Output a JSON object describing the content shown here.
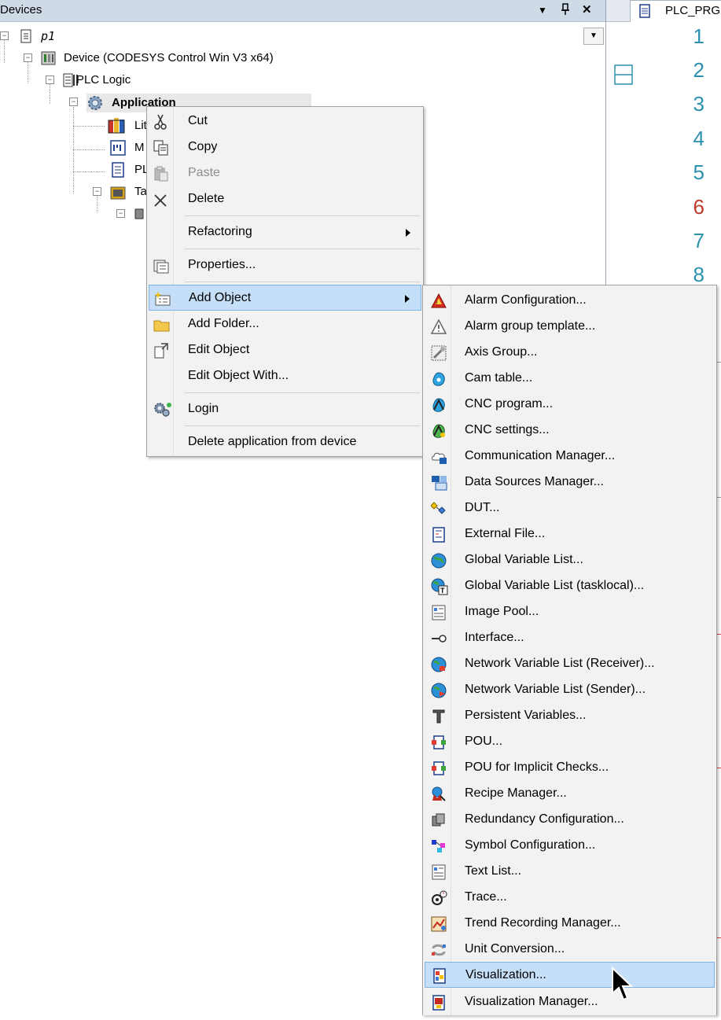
{
  "devices_panel": {
    "title": "Devices",
    "dropdown_glyph": "▼",
    "pin_glyph": "ᛘ",
    "close_glyph": "✕",
    "project_name": "p1",
    "device_label": "Device (CODESYS Control Win V3 x64)",
    "plc_logic_label": "PLC Logic",
    "application_label": "Application",
    "hidden_children_visible_text": [
      "Lit",
      "M",
      "PL",
      "Ta"
    ]
  },
  "editor": {
    "tab_label": "PLC_PRG",
    "line_numbers": [
      "1",
      "2",
      "3",
      "4",
      "5",
      "6",
      "7",
      "8"
    ],
    "error_line_color": "#c0392b",
    "line_number_color": "#2b91af"
  },
  "context_menu": {
    "items": [
      {
        "label": "Cut",
        "icon": "scissors-icon",
        "enabled": true
      },
      {
        "label": "Copy",
        "icon": "copy-icon",
        "enabled": true
      },
      {
        "label": "Paste",
        "icon": "paste-icon",
        "enabled": false
      },
      {
        "label": "Delete",
        "icon": "delete-x-icon",
        "enabled": true
      },
      {
        "label": "Refactoring",
        "submenu": true
      },
      {
        "label": "Properties...",
        "icon": "properties-icon"
      },
      {
        "label": "Add Object",
        "icon": "add-object-icon",
        "submenu": true,
        "highlighted": true
      },
      {
        "label": "Add Folder...",
        "icon": "folder-icon"
      },
      {
        "label": "Edit Object",
        "icon": "edit-object-icon"
      },
      {
        "label": "Edit Object With..."
      },
      {
        "label": "Login",
        "icon": "login-gears-icon"
      },
      {
        "label": "Delete application from device"
      }
    ]
  },
  "add_object_submenu": {
    "items": [
      {
        "label": "Alarm Configuration...",
        "icon": "alarm-configuration-icon"
      },
      {
        "label": "Alarm group template...",
        "icon": "alarm-group-template-icon"
      },
      {
        "label": "Axis Group...",
        "icon": "axis-group-icon"
      },
      {
        "label": "Cam table...",
        "icon": "cam-table-icon"
      },
      {
        "label": "CNC program...",
        "icon": "cnc-program-icon"
      },
      {
        "label": "CNC settings...",
        "icon": "cnc-settings-icon"
      },
      {
        "label": "Communication Manager...",
        "icon": "communication-manager-icon"
      },
      {
        "label": "Data Sources Manager...",
        "icon": "data-sources-manager-icon"
      },
      {
        "label": "DUT...",
        "icon": "dut-icon"
      },
      {
        "label": "External File...",
        "icon": "external-file-icon"
      },
      {
        "label": "Global Variable List...",
        "icon": "global-variable-list-icon"
      },
      {
        "label": "Global Variable List (tasklocal)...",
        "icon": "global-variable-list-tasklocal-icon"
      },
      {
        "label": "Image Pool...",
        "icon": "image-pool-icon"
      },
      {
        "label": "Interface...",
        "icon": "interface-icon"
      },
      {
        "label": "Network Variable List (Receiver)...",
        "icon": "network-variable-receiver-icon"
      },
      {
        "label": "Network Variable List (Sender)...",
        "icon": "network-variable-sender-icon"
      },
      {
        "label": "Persistent Variables...",
        "icon": "persistent-variables-icon"
      },
      {
        "label": "POU...",
        "icon": "pou-icon"
      },
      {
        "label": "POU for Implicit Checks...",
        "icon": "pou-implicit-checks-icon"
      },
      {
        "label": "Recipe Manager...",
        "icon": "recipe-manager-icon"
      },
      {
        "label": "Redundancy Configuration...",
        "icon": "redundancy-configuration-icon"
      },
      {
        "label": "Symbol Configuration...",
        "icon": "symbol-configuration-icon"
      },
      {
        "label": "Text List...",
        "icon": "text-list-icon"
      },
      {
        "label": "Trace...",
        "icon": "trace-icon"
      },
      {
        "label": "Trend Recording Manager...",
        "icon": "trend-recording-manager-icon"
      },
      {
        "label": "Unit Conversion...",
        "icon": "unit-conversion-icon"
      },
      {
        "label": "Visualization...",
        "icon": "visualization-icon",
        "highlighted": true
      },
      {
        "label": "Visualization Manager...",
        "icon": "visualization-manager-icon"
      }
    ]
  },
  "colors": {
    "highlight_bg": "#c5dff8",
    "highlight_border": "#7fb3e6",
    "menu_bg": "#f2f2f2",
    "panel_header": "#cfdae7"
  }
}
